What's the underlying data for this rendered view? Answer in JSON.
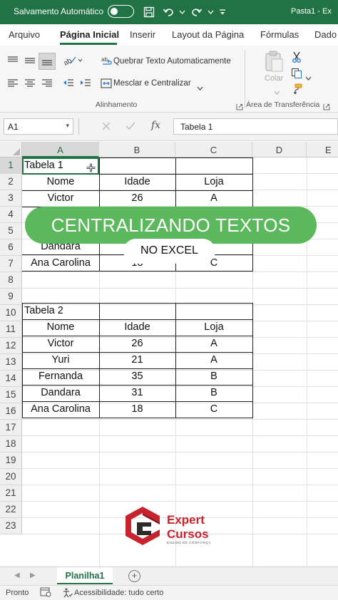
{
  "titlebar": {
    "autosave_label": "Salvamento Automático",
    "filename": "Pasta1 - Ex"
  },
  "ribbon_tabs": [
    "Arquivo",
    "Página Inicial",
    "Inserir",
    "Layout da Página",
    "Fórmulas",
    "Dado"
  ],
  "ribbon": {
    "wrap_text": "Quebrar Texto Automaticamente",
    "merge_center": "Mesclar e Centralizar",
    "group_alignment": "Alinhamento",
    "paste": "Colar",
    "group_clipboard": "Área de Transferência"
  },
  "formula_bar": {
    "name_box": "A1",
    "fx": "fx",
    "content": "Tabela 1"
  },
  "columns": [
    "A",
    "B",
    "C",
    "D",
    "E"
  ],
  "rows": [
    "1",
    "2",
    "3",
    "4",
    "5",
    "6",
    "7",
    "8",
    "9",
    "10",
    "11",
    "12",
    "13",
    "14",
    "15",
    "16",
    "17",
    "18",
    "19",
    "20",
    "21",
    "22",
    "23"
  ],
  "table1": {
    "title": "Tabela 1",
    "headers": [
      "Nome",
      "Idade",
      "Loja"
    ],
    "rows": [
      [
        "Victor",
        "26",
        "A"
      ],
      [
        "Dandara",
        "",
        ""
      ],
      [
        "Ana Carolina",
        "18",
        "C"
      ]
    ]
  },
  "table2": {
    "title": "Tabela 2",
    "headers": [
      "Nome",
      "Idade",
      "Loja"
    ],
    "rows": [
      [
        "Victor",
        "26",
        "A"
      ],
      [
        "Yuri",
        "21",
        "A"
      ],
      [
        "Fernanda",
        "35",
        "B"
      ],
      [
        "Dandara",
        "31",
        "B"
      ],
      [
        "Ana Carolina",
        "18",
        "C"
      ]
    ]
  },
  "overlay": {
    "headline": "CENTRALIZANDO TEXTOS",
    "subline": "NO EXCEL"
  },
  "logo": {
    "line1": "Expert",
    "line2": "Cursos",
    "tagline": "ENSINO DE CONFIANÇA"
  },
  "sheets": {
    "active": "Planilha1",
    "add": "+"
  },
  "status": {
    "ready": "Pronto",
    "accessibility": "Acessibilidade: tudo certo"
  },
  "colors": {
    "excel_green": "#217346",
    "banner_green": "#5cb85c",
    "logo_red": "#c8232c"
  }
}
